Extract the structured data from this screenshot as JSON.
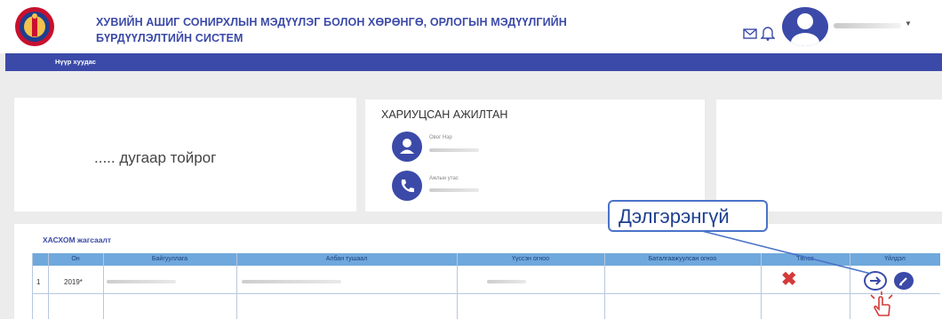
{
  "header": {
    "title_line1": "ХУВИЙН АШИГ СОНИРХЛЫН МЭДҮҮЛЭГ БОЛОН ХӨРӨНГӨ, ОРЛОГЫН МЭДҮҮЛГИЙН",
    "title_line2": "БҮРДҮҮЛЭЛТИЙН СИСТЕМ",
    "icons": [
      "mail-icon",
      "bell-icon",
      "user-avatar",
      "caret-down-icon"
    ]
  },
  "nav": {
    "home": "Нүүр хуудас"
  },
  "circle_card": {
    "text": "..... дугаар тойрог"
  },
  "employee_card": {
    "title": "ХАРИУЦСАН АЖИЛТАН",
    "name_label": "Овог Нэр",
    "phone_label": "Ажлын утас"
  },
  "table": {
    "title": "ХАСХОМ жагсаалт",
    "columns": [
      "",
      "Он",
      "Байгууллага",
      "Албан тушаал",
      "Үүссэн огноо",
      "Баталгаажуулсан огноо",
      "Төлөв",
      "Үйлдэл"
    ],
    "rows": [
      {
        "index": "1",
        "year": "2019*"
      }
    ]
  },
  "callout": {
    "text": "Дэлгэрэнгүй"
  },
  "colors": {
    "brand": "#3b4aa8",
    "table_header": "#6fa8dc",
    "status_rejected": "#d43a3a",
    "callout_border": "#4a73c9"
  }
}
